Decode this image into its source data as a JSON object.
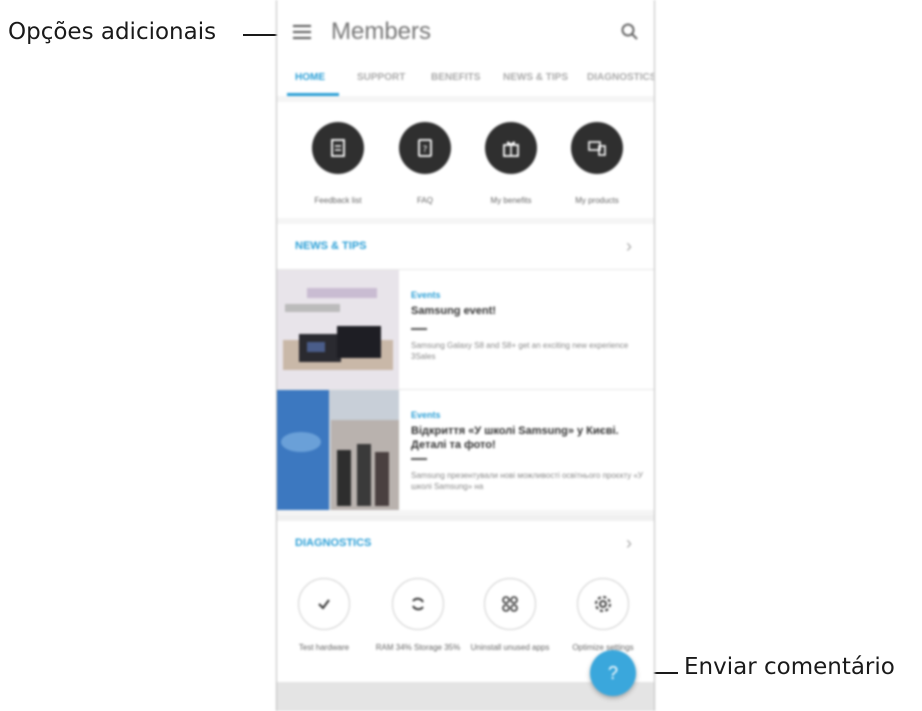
{
  "callouts": {
    "options": "Opções adicionais",
    "feedback": "Enviar comentário"
  },
  "app": {
    "title": "Members",
    "menu_icon": "menu-icon",
    "search_icon": "search-icon"
  },
  "tabs": [
    {
      "label": "HOME",
      "active": true
    },
    {
      "label": "SUPPORT",
      "active": false
    },
    {
      "label": "BENEFITS",
      "active": false
    },
    {
      "label": "NEWS & TIPS",
      "active": false
    },
    {
      "label": "DIAGNOSTICS",
      "active": false
    }
  ],
  "quick_actions": [
    {
      "label": "Feedback list",
      "icon": "document-icon"
    },
    {
      "label": "FAQ",
      "icon": "faq-icon"
    },
    {
      "label": "My benefits",
      "icon": "gift-icon"
    },
    {
      "label": "My products",
      "icon": "devices-icon"
    }
  ],
  "news_section": {
    "title": "NEWS & TIPS",
    "items": [
      {
        "category": "Events",
        "title": "Samsung event!",
        "description": "Samsung Galaxy S8 and S8+ get an exciting new experience 3Sales"
      },
      {
        "category": "Events",
        "title": "Відкриття «У школі Samsung» у Києві. Деталі та фото!",
        "description": "Samsung презентували нові можливості освітнього проєкту «У школі Samsung» на"
      }
    ]
  },
  "diagnostics_section": {
    "title": "DIAGNOSTICS",
    "items": [
      {
        "label": "Test hardware",
        "icon": "check-icon"
      },
      {
        "label": "RAM 34% Storage 35%",
        "icon": "refresh-icon"
      },
      {
        "label": "Uninstall unused apps",
        "icon": "apps-icon"
      },
      {
        "label": "Optimize settings",
        "icon": "gear-icon"
      }
    ]
  },
  "fab": {
    "label": "?",
    "icon": "help-icon"
  },
  "colors": {
    "accent": "#2b9fd6",
    "fab": "#3aa7dc",
    "dark_circle": "#2f2f2f"
  }
}
